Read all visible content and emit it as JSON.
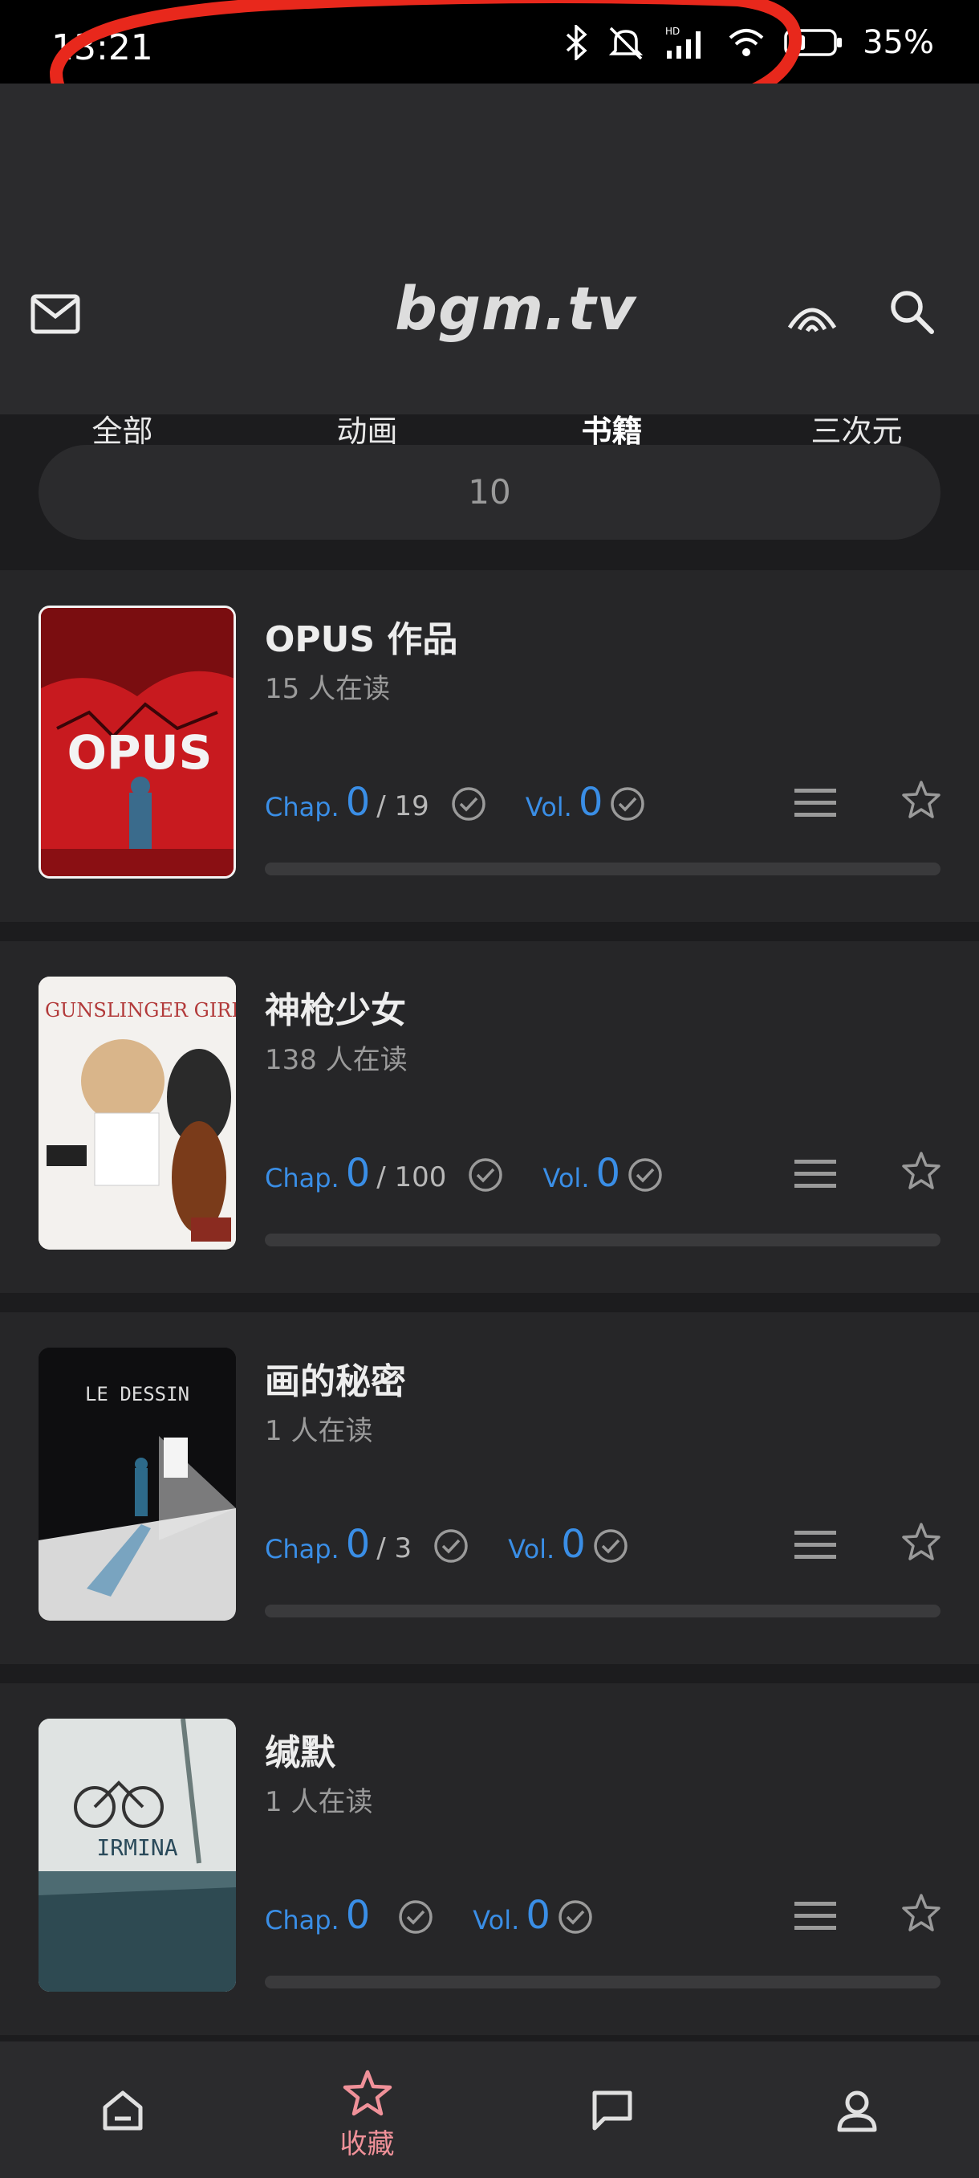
{
  "status_bar": {
    "time": "13:21",
    "battery": "35%"
  },
  "header": {
    "logo": "bgm.tv",
    "icons": [
      "mail-icon",
      "broadcast-icon",
      "search-icon"
    ]
  },
  "tabs": [
    {
      "label": "全部"
    },
    {
      "label": "动画"
    },
    {
      "label": "书籍",
      "active": true
    },
    {
      "label": "三次元"
    }
  ],
  "pager": {
    "value": "10"
  },
  "items": [
    {
      "title": "OPUS 作品",
      "reading": "15 人在读",
      "chap_label": "Chap.",
      "chap_value": "0",
      "chap_total": "/ 19",
      "vol_label": "Vol.",
      "vol_value": "0",
      "progress": 0
    },
    {
      "title": "神枪少女",
      "reading": "138 人在读",
      "chap_label": "Chap.",
      "chap_value": "0",
      "chap_total": "/ 100",
      "vol_label": "Vol.",
      "vol_value": "0",
      "progress": 0
    },
    {
      "title": "画的秘密",
      "reading": "1 人在读",
      "chap_label": "Chap.",
      "chap_value": "0",
      "chap_total": "/ 3",
      "vol_label": "Vol.",
      "vol_value": "0",
      "progress": 0
    },
    {
      "title": "缄默",
      "reading": "1 人在读",
      "chap_label": "Chap.",
      "chap_value": "0",
      "chap_total": "",
      "vol_label": "Vol.",
      "vol_value": "0",
      "progress": 0
    }
  ],
  "bottom_nav": [
    {
      "icon": "home-icon",
      "label": ""
    },
    {
      "icon": "star-icon",
      "label": "收藏",
      "active": true
    },
    {
      "icon": "chat-icon",
      "label": ""
    },
    {
      "icon": "user-icon",
      "label": ""
    }
  ],
  "colors": {
    "accent": "#f09199",
    "link": "#3a8ee6",
    "background": "#1c1c1e",
    "surface": "#262628"
  }
}
